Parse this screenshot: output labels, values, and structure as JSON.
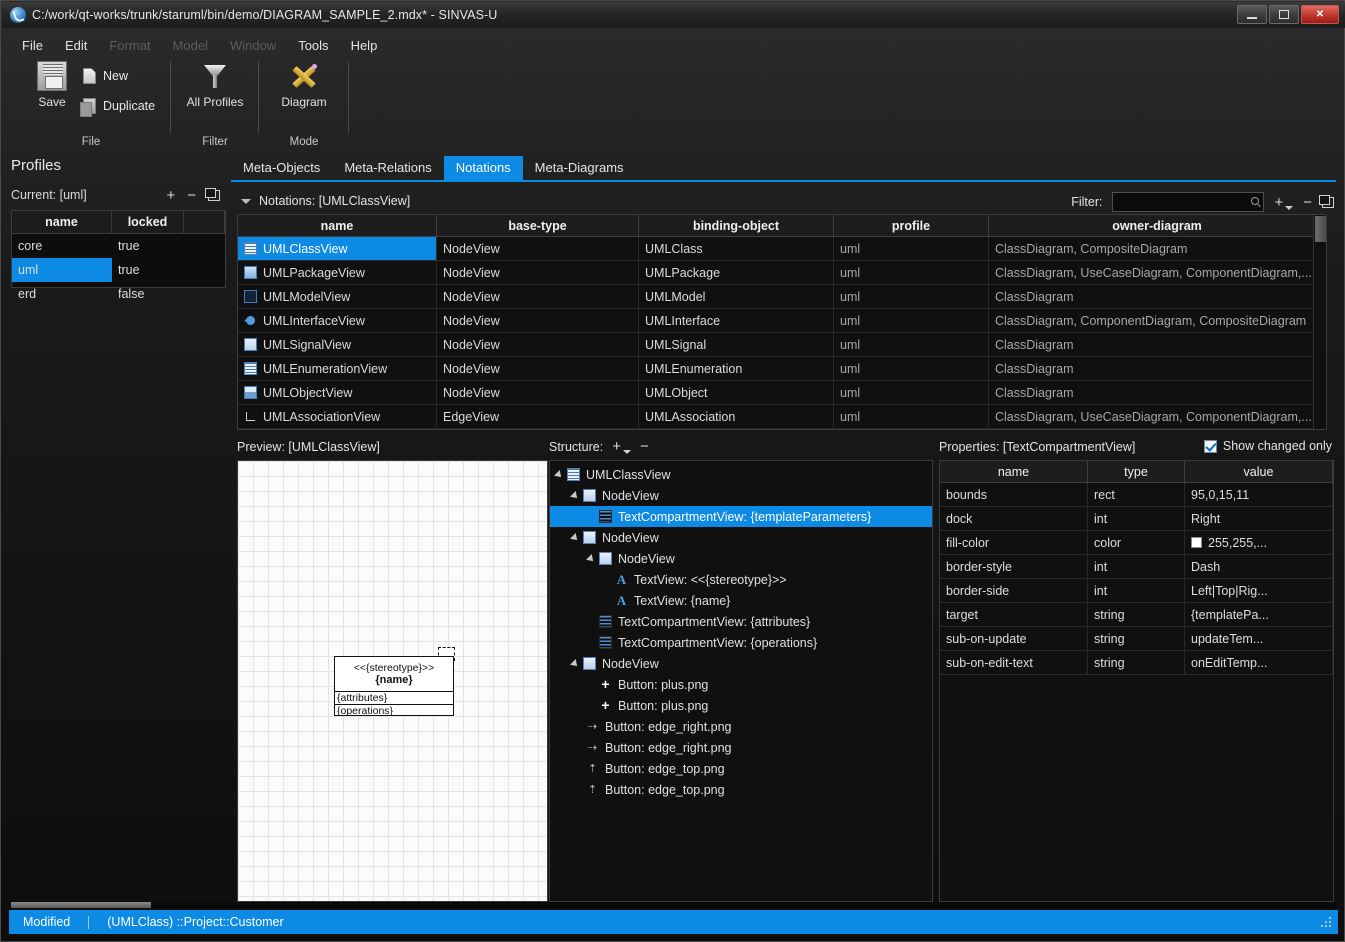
{
  "window": {
    "title": "C:/work/qt-works/trunk/staruml/bin/demo/DIAGRAM_SAMPLE_2.mdx* - SINVAS-U",
    "minimize_label": "Minimize",
    "maximize_label": "Maximize",
    "close_label": "✕"
  },
  "menu": [
    {
      "label": "File",
      "disabled": false
    },
    {
      "label": "Edit",
      "disabled": false
    },
    {
      "label": "Format",
      "disabled": true
    },
    {
      "label": "Model",
      "disabled": true
    },
    {
      "label": "Window",
      "disabled": true
    },
    {
      "label": "Tools",
      "disabled": false
    },
    {
      "label": "Help",
      "disabled": false
    }
  ],
  "ribbon": {
    "groups": [
      {
        "caption": "File"
      },
      {
        "caption": "Filter"
      },
      {
        "caption": "Mode"
      }
    ],
    "save_label": "Save",
    "new_label": "New",
    "duplicate_label": "Duplicate",
    "all_profiles_label": "All Profiles",
    "diagram_label": "Diagram"
  },
  "profiles": {
    "title": "Profiles",
    "current_label": "Current: [uml]",
    "add_label": "+",
    "remove_label": "−",
    "copy_label": "copy",
    "columns": [
      "name",
      "locked",
      ""
    ],
    "rows": [
      {
        "name": "core",
        "locked": "true",
        "selected": false
      },
      {
        "name": "uml",
        "locked": "true",
        "selected": true
      },
      {
        "name": "erd",
        "locked": "false",
        "selected": false
      }
    ]
  },
  "tabs": [
    {
      "label": "Meta-Objects",
      "active": false
    },
    {
      "label": "Meta-Relations",
      "active": false
    },
    {
      "label": "Notations",
      "active": true
    },
    {
      "label": "Meta-Diagrams",
      "active": false
    }
  ],
  "notations": {
    "header_label": "Notations: [UMLClassView]",
    "filter_label": "Filter:",
    "filter_value": "",
    "filter_placeholder": "",
    "add_label": "+",
    "remove_label": "−",
    "copy_label": "copy",
    "columns": [
      "name",
      "base-type",
      "binding-object",
      "profile",
      "owner-diagram"
    ],
    "rows": [
      {
        "name": "UMLClassView",
        "base_type": "NodeView",
        "binding_object": "UMLClass",
        "profile": "uml",
        "owner_diagram": "ClassDiagram, CompositeDiagram",
        "selected": true,
        "icon": "class-icon"
      },
      {
        "name": "UMLPackageView",
        "base_type": "NodeView",
        "binding_object": "UMLPackage",
        "profile": "uml",
        "owner_diagram": "ClassDiagram, UseCaseDiagram, ComponentDiagram,...",
        "selected": false,
        "icon": "package-icon"
      },
      {
        "name": "UMLModelView",
        "base_type": "NodeView",
        "binding_object": "UMLModel",
        "profile": "uml",
        "owner_diagram": "ClassDiagram",
        "selected": false,
        "icon": "model-icon"
      },
      {
        "name": "UMLInterfaceView",
        "base_type": "NodeView",
        "binding_object": "UMLInterface",
        "profile": "uml",
        "owner_diagram": "ClassDiagram, ComponentDiagram, CompositeDiagram",
        "selected": false,
        "icon": "interface-icon"
      },
      {
        "name": "UMLSignalView",
        "base_type": "NodeView",
        "binding_object": "UMLSignal",
        "profile": "uml",
        "owner_diagram": "ClassDiagram",
        "selected": false,
        "icon": "signal-icon"
      },
      {
        "name": "UMLEnumerationView",
        "base_type": "NodeView",
        "binding_object": "UMLEnumeration",
        "profile": "uml",
        "owner_diagram": "ClassDiagram",
        "selected": false,
        "icon": "enumeration-icon"
      },
      {
        "name": "UMLObjectView",
        "base_type": "NodeView",
        "binding_object": "UMLObject",
        "profile": "uml",
        "owner_diagram": "ClassDiagram",
        "selected": false,
        "icon": "object-icon"
      },
      {
        "name": "UMLAssociationView",
        "base_type": "EdgeView",
        "binding_object": "UMLAssociation",
        "profile": "uml",
        "owner_diagram": "ClassDiagram, UseCaseDiagram, ComponentDiagram,...",
        "selected": false,
        "icon": "association-icon"
      }
    ]
  },
  "preview": {
    "header_label": "Preview: [UMLClassView]",
    "shape": {
      "stereotype": "<<{stereotype}>>",
      "name": "{name}",
      "attributes": "{attributes}",
      "operations": "{operations}"
    }
  },
  "structure": {
    "header_label": "Structure:",
    "add_label": "+",
    "remove_label": "−",
    "nodes": [
      {
        "label": "UMLClassView",
        "depth": 0,
        "twisty": true,
        "icon": "class-icon",
        "selected": false
      },
      {
        "label": "NodeView",
        "depth": 1,
        "twisty": true,
        "icon": "node-icon",
        "selected": false
      },
      {
        "label": "TextCompartmentView: {templateParameters}",
        "depth": 2,
        "twisty": false,
        "icon": "text-compartment-icon",
        "selected": true
      },
      {
        "label": "NodeView",
        "depth": 1,
        "twisty": true,
        "icon": "node-icon",
        "selected": false
      },
      {
        "label": "NodeView",
        "depth": 2,
        "twisty": true,
        "icon": "node-icon",
        "selected": false
      },
      {
        "label": "TextView: <<{stereotype}>>",
        "depth": 3,
        "twisty": false,
        "icon": "text-icon",
        "selected": false
      },
      {
        "label": "TextView: {name}",
        "depth": 3,
        "twisty": false,
        "icon": "text-icon",
        "selected": false
      },
      {
        "label": "TextCompartmentView: {attributes}",
        "depth": 2,
        "twisty": false,
        "icon": "text-compartment-icon",
        "selected": false
      },
      {
        "label": "TextCompartmentView: {operations}",
        "depth": 2,
        "twisty": false,
        "icon": "text-compartment-icon",
        "selected": false
      },
      {
        "label": "NodeView",
        "depth": 1,
        "twisty": true,
        "icon": "node-icon",
        "selected": false
      },
      {
        "label": "Button: plus.png",
        "depth": 2,
        "twisty": false,
        "icon": "plus-icon",
        "selected": false
      },
      {
        "label": "Button: plus.png",
        "depth": 2,
        "twisty": false,
        "icon": "plus-icon",
        "selected": false
      },
      {
        "label": "Button: edge_right.png",
        "depth": 1,
        "twisty": false,
        "icon": "arrow-right-icon",
        "selected": false
      },
      {
        "label": "Button: edge_right.png",
        "depth": 1,
        "twisty": false,
        "icon": "arrow-right-icon",
        "selected": false
      },
      {
        "label": "Button: edge_top.png",
        "depth": 1,
        "twisty": false,
        "icon": "arrow-up-icon",
        "selected": false
      },
      {
        "label": "Button: edge_top.png",
        "depth": 1,
        "twisty": false,
        "icon": "arrow-up-icon",
        "selected": false
      }
    ]
  },
  "properties": {
    "header_label": "Properties: [TextCompartmentView]",
    "show_changed_only_label": "Show changed only",
    "show_changed_only_checked": true,
    "columns": [
      "name",
      "type",
      "value"
    ],
    "rows": [
      {
        "name": "bounds",
        "type": "rect",
        "value": "95,0,15,11",
        "swatch": false
      },
      {
        "name": "dock",
        "type": "int",
        "value": "Right",
        "swatch": false
      },
      {
        "name": "fill-color",
        "type": "color",
        "value": "255,255,...",
        "swatch": true,
        "swatch_color": "#ffffff"
      },
      {
        "name": "border-style",
        "type": "int",
        "value": "Dash",
        "swatch": false
      },
      {
        "name": "border-side",
        "type": "int",
        "value": "Left|Top|Rig...",
        "swatch": false
      },
      {
        "name": "target",
        "type": "string",
        "value": "{templatePa...",
        "swatch": false
      },
      {
        "name": "sub-on-update",
        "type": "string",
        "value": "updateTem...",
        "swatch": false
      },
      {
        "name": "sub-on-edit-text",
        "type": "string",
        "value": "onEditTemp...",
        "swatch": false
      }
    ]
  },
  "statusbar": {
    "state": "Modified",
    "selection": "(UMLClass) ::Project::Customer"
  },
  "colors": {
    "accent": "#0d8ae3",
    "window_bg": "#000000",
    "panel_bg": "#101010",
    "header_bg": "#1d1d1d",
    "border": "#3c3c3c",
    "text": "#dcdcdc",
    "close_button": "#c23a31"
  }
}
